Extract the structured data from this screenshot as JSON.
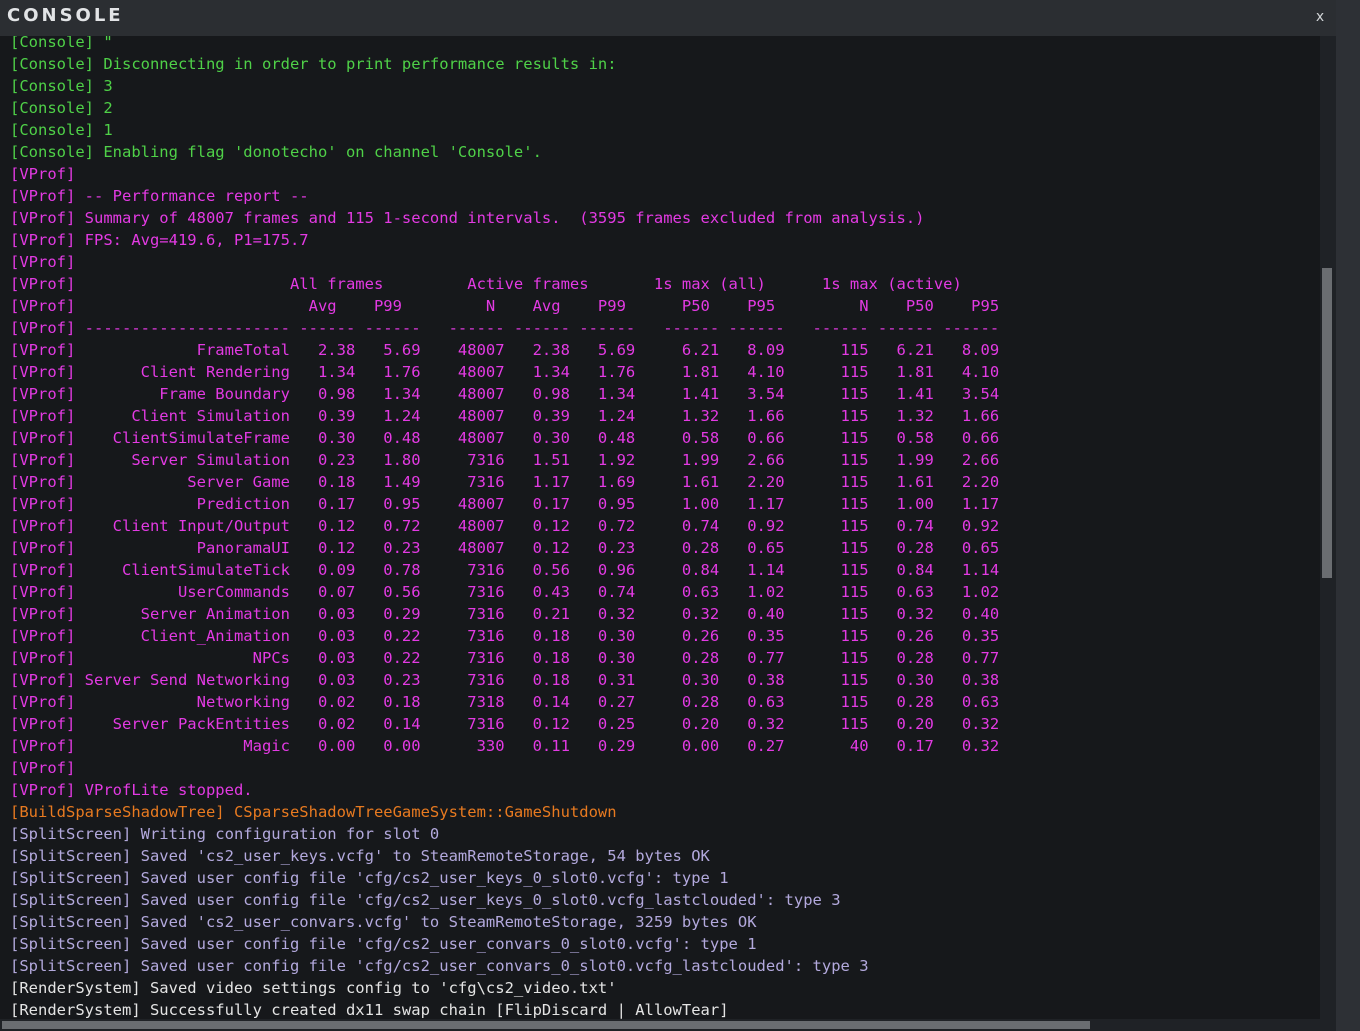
{
  "window": {
    "title": "CONSOLE",
    "close_label": "x"
  },
  "colors": {
    "console": "#4fd148",
    "vprof": "#e33ae3",
    "build": "#e87a20",
    "split": "#b3a9dd",
    "render": "#e4e4e4",
    "background": "#16181b"
  },
  "log": [
    {
      "channel": "console",
      "text": "[Console] \""
    },
    {
      "channel": "console",
      "text": "[Console] Disconnecting in order to print performance results in:"
    },
    {
      "channel": "console",
      "text": "[Console] 3"
    },
    {
      "channel": "console",
      "text": "[Console] 2"
    },
    {
      "channel": "console",
      "text": "[Console] 1"
    },
    {
      "channel": "console",
      "text": "[Console] Enabling flag 'donotecho' on channel 'Console'."
    },
    {
      "channel": "vprof",
      "text": "[VProf]"
    },
    {
      "channel": "vprof",
      "text": "[VProf] -- Performance report --"
    },
    {
      "channel": "vprof",
      "text": "[VProf] Summary of 48007 frames and 115 1-second intervals.  (3595 frames excluded from analysis.)"
    },
    {
      "channel": "vprof",
      "text": "[VProf] FPS: Avg=419.6, P1=175.7"
    },
    {
      "channel": "vprof",
      "text": "[VProf]"
    },
    {
      "channel": "vprof",
      "text": "[VProf]                       All frames         Active frames       1s max (all)      1s max (active)"
    },
    {
      "channel": "vprof",
      "text": "[VProf]                         Avg    P99         N    Avg    P99      P50    P95         N    P50    P95"
    },
    {
      "channel": "vprof",
      "text": "[VProf] ---------------------- ------ ------   ------ ------ ------   ------ ------   ------ ------ ------"
    },
    {
      "channel": "vprof",
      "text": "[VProf]             FrameTotal   2.38   5.69    48007   2.38   5.69     6.21   8.09      115   6.21   8.09"
    },
    {
      "channel": "vprof",
      "text": "[VProf]       Client Rendering   1.34   1.76    48007   1.34   1.76     1.81   4.10      115   1.81   4.10"
    },
    {
      "channel": "vprof",
      "text": "[VProf]         Frame Boundary   0.98   1.34    48007   0.98   1.34     1.41   3.54      115   1.41   3.54"
    },
    {
      "channel": "vprof",
      "text": "[VProf]      Client Simulation   0.39   1.24    48007   0.39   1.24     1.32   1.66      115   1.32   1.66"
    },
    {
      "channel": "vprof",
      "text": "[VProf]    ClientSimulateFrame   0.30   0.48    48007   0.30   0.48     0.58   0.66      115   0.58   0.66"
    },
    {
      "channel": "vprof",
      "text": "[VProf]      Server Simulation   0.23   1.80     7316   1.51   1.92     1.99   2.66      115   1.99   2.66"
    },
    {
      "channel": "vprof",
      "text": "[VProf]            Server Game   0.18   1.49     7316   1.17   1.69     1.61   2.20      115   1.61   2.20"
    },
    {
      "channel": "vprof",
      "text": "[VProf]             Prediction   0.17   0.95    48007   0.17   0.95     1.00   1.17      115   1.00   1.17"
    },
    {
      "channel": "vprof",
      "text": "[VProf]    Client Input/Output   0.12   0.72    48007   0.12   0.72     0.74   0.92      115   0.74   0.92"
    },
    {
      "channel": "vprof",
      "text": "[VProf]             PanoramaUI   0.12   0.23    48007   0.12   0.23     0.28   0.65      115   0.28   0.65"
    },
    {
      "channel": "vprof",
      "text": "[VProf]     ClientSimulateTick   0.09   0.78     7316   0.56   0.96     0.84   1.14      115   0.84   1.14"
    },
    {
      "channel": "vprof",
      "text": "[VProf]           UserCommands   0.07   0.56     7316   0.43   0.74     0.63   1.02      115   0.63   1.02"
    },
    {
      "channel": "vprof",
      "text": "[VProf]       Server Animation   0.03   0.29     7316   0.21   0.32     0.32   0.40      115   0.32   0.40"
    },
    {
      "channel": "vprof",
      "text": "[VProf]       Client_Animation   0.03   0.22     7316   0.18   0.30     0.26   0.35      115   0.26   0.35"
    },
    {
      "channel": "vprof",
      "text": "[VProf]                   NPCs   0.03   0.22     7316   0.18   0.30     0.28   0.77      115   0.28   0.77"
    },
    {
      "channel": "vprof",
      "text": "[VProf] Server Send Networking   0.03   0.23     7316   0.18   0.31     0.30   0.38      115   0.30   0.38"
    },
    {
      "channel": "vprof",
      "text": "[VProf]             Networking   0.02   0.18     7318   0.14   0.27     0.28   0.63      115   0.28   0.63"
    },
    {
      "channel": "vprof",
      "text": "[VProf]    Server PackEntities   0.02   0.14     7316   0.12   0.25     0.20   0.32      115   0.20   0.32"
    },
    {
      "channel": "vprof",
      "text": "[VProf]                  Magic   0.00   0.00      330   0.11   0.29     0.00   0.27       40   0.17   0.32"
    },
    {
      "channel": "vprof",
      "text": "[VProf]"
    },
    {
      "channel": "vprof",
      "text": "[VProf] VProfLite stopped."
    },
    {
      "channel": "build",
      "text": "[BuildSparseShadowTree] CSparseShadowTreeGameSystem::GameShutdown"
    },
    {
      "channel": "split",
      "text": "[SplitScreen] Writing configuration for slot 0"
    },
    {
      "channel": "split",
      "text": "[SplitScreen] Saved 'cs2_user_keys.vcfg' to SteamRemoteStorage, 54 bytes OK"
    },
    {
      "channel": "split",
      "text": "[SplitScreen] Saved user config file 'cfg/cs2_user_keys_0_slot0.vcfg': type 1"
    },
    {
      "channel": "split",
      "text": "[SplitScreen] Saved user config file 'cfg/cs2_user_keys_0_slot0.vcfg_lastclouded': type 3"
    },
    {
      "channel": "split",
      "text": "[SplitScreen] Saved 'cs2_user_convars.vcfg' to SteamRemoteStorage, 3259 bytes OK"
    },
    {
      "channel": "split",
      "text": "[SplitScreen] Saved user config file 'cfg/cs2_user_convars_0_slot0.vcfg': type 1"
    },
    {
      "channel": "split",
      "text": "[SplitScreen] Saved user config file 'cfg/cs2_user_convars_0_slot0.vcfg_lastclouded': type 3"
    },
    {
      "channel": "render",
      "text": "[RenderSystem] Saved video settings config to 'cfg\\cs2_video.txt'"
    },
    {
      "channel": "render",
      "text": "[RenderSystem] Successfully created dx11 swap chain [FlipDiscard | AllowTear]"
    }
  ]
}
